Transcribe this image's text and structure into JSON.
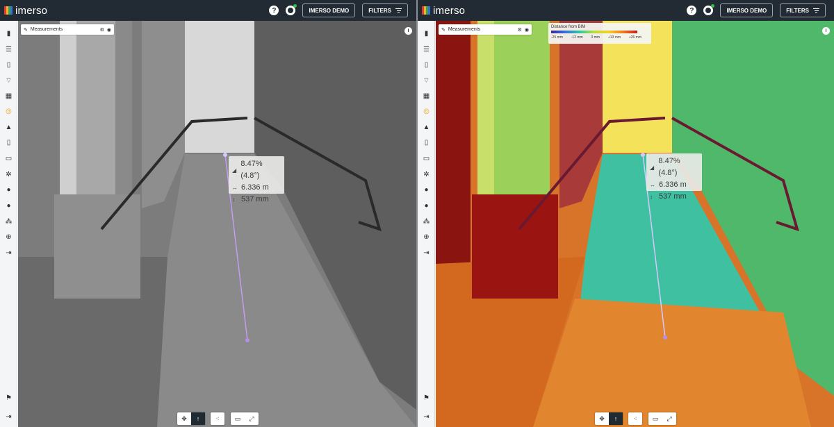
{
  "brand": {
    "name": "imerso",
    "logo_colors": [
      "#e23c2c",
      "#f2b22b",
      "#35a853",
      "#3a6fd8"
    ]
  },
  "header": {
    "help_label": "?",
    "help_icon": "question-icon",
    "user_icon": "user-status-icon",
    "project_label": "IMERSO DEMO",
    "filters_label": "FILTERS",
    "filters_icon": "filter-lines-icon"
  },
  "sidebar": {
    "items": [
      {
        "icon": "bar-chart-icon",
        "glyph": "▮"
      },
      {
        "icon": "list-icon",
        "glyph": "☰"
      },
      {
        "icon": "document-icon",
        "glyph": "▯"
      },
      {
        "icon": "signal-icon",
        "glyph": "⌔"
      },
      {
        "icon": "floorplan-icon",
        "glyph": "▦"
      },
      {
        "icon": "target-icon",
        "glyph": "◎"
      },
      {
        "icon": "building-icon",
        "glyph": "▲"
      },
      {
        "icon": "pdf-icon",
        "glyph": "▯"
      },
      {
        "icon": "frame-icon",
        "glyph": "▭"
      },
      {
        "icon": "settings-icon",
        "glyph": "✲"
      },
      {
        "icon": "team-icon",
        "glyph": "●"
      },
      {
        "icon": "user-icon",
        "glyph": "●"
      },
      {
        "icon": "cluster-icon",
        "glyph": "⁂"
      },
      {
        "icon": "globe-icon",
        "glyph": "⊕"
      },
      {
        "icon": "logout-icon",
        "glyph": "⇥"
      }
    ],
    "bottom": [
      {
        "icon": "flag-icon",
        "glyph": "⚑"
      },
      {
        "icon": "collapse-icon",
        "glyph": "⇥"
      }
    ]
  },
  "measurements_panel": {
    "title": "Measurements",
    "edit_icon": "pencil-icon",
    "settings_icon": "sliders-icon",
    "visibility_icon": "eye-icon"
  },
  "info_label": "i",
  "measurement": {
    "slope": "8.47% (4.8°)",
    "distance": "6.336 m",
    "height": "537 mm"
  },
  "legend": {
    "title": "Distance from BIM",
    "ticks": [
      "-25 mm",
      "-12 mm",
      "0 mm",
      "+13 mm",
      "+26 mm"
    ]
  },
  "toolbar": {
    "buttons": [
      "move-icon",
      "walk-icon",
      "share-icon",
      "screen-icon",
      "fullscreen-icon"
    ]
  }
}
